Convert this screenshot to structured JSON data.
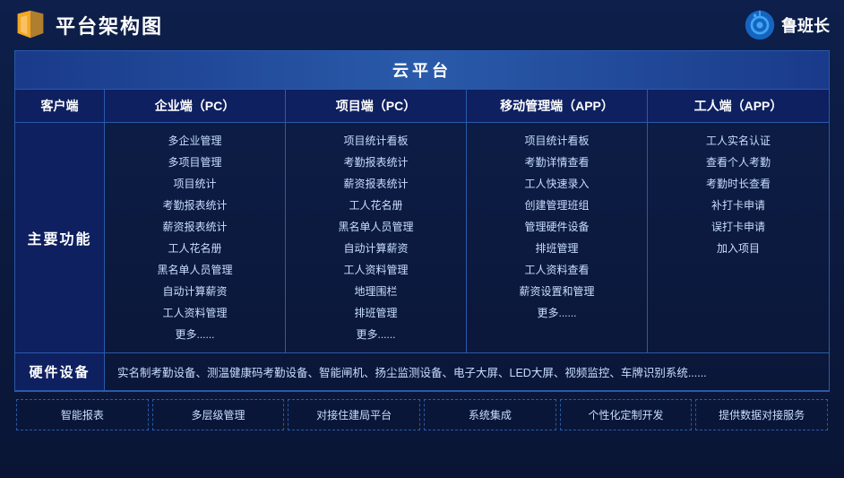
{
  "header": {
    "title": "平台架构图",
    "brand": "鲁班长"
  },
  "cloud_platform": "云平台",
  "columns": [
    {
      "label": "客户端"
    },
    {
      "label": "企业端（PC）"
    },
    {
      "label": "项目端（PC）"
    },
    {
      "label": "移动管理端（APP）"
    },
    {
      "label": "工人端（APP）"
    }
  ],
  "main_section": {
    "label": "主要功能",
    "col1_items": [
      "多企业管理",
      "多项目管理",
      "项目统计",
      "考勤报表统计",
      "薪资报表统计",
      "工人花名册",
      "黑名单人员管理",
      "自动计算薪资",
      "工人资料管理",
      "更多......"
    ],
    "col2_items": [
      "项目统计看板",
      "考勤报表统计",
      "薪资报表统计",
      "工人花名册",
      "黑名单人员管理",
      "自动计算薪资",
      "工人资料管理",
      "地理围栏",
      "排班管理",
      "更多......"
    ],
    "col3_items": [
      "项目统计看板",
      "考勤详情查看",
      "工人快速录入",
      "创建管理班组",
      "管理硬件设备",
      "排班管理",
      "工人资料查看",
      "薪资设置和管理",
      "更多......"
    ],
    "col4_items": [
      "工人实名认证",
      "查看个人考勤",
      "考勤时长查看",
      "补打卡申请",
      "误打卡申请",
      "加入项目"
    ]
  },
  "hardware": {
    "label": "硬件设备",
    "content": "实名制考勤设备、测温健康码考勤设备、智能闸机、扬尘监测设备、电子大屏、LED大屏、视频监控、车牌识别系统......"
  },
  "features": [
    "智能报表",
    "多层级管理",
    "对接住建局平台",
    "系统集成",
    "个性化定制开发",
    "提供数据对接服务"
  ]
}
